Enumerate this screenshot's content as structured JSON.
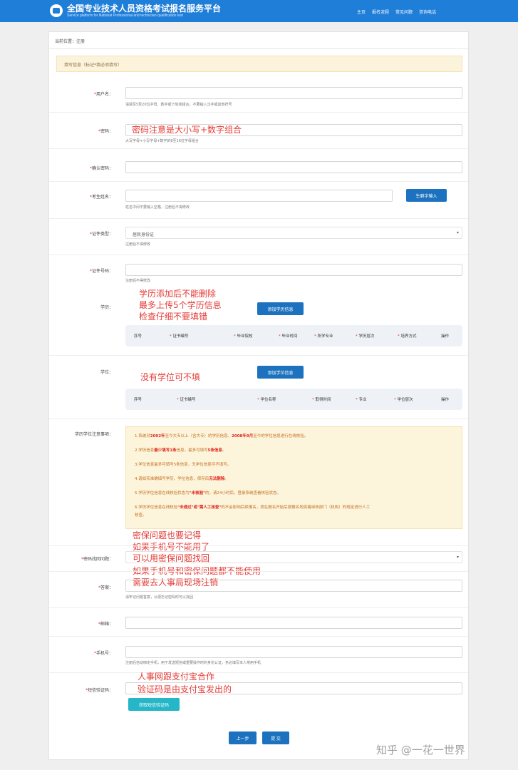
{
  "header": {
    "title": "全国专业技术人员资格考试报名服务平台",
    "subtitle": "Service platform for National Professional and technician qualification test",
    "logo_text": "PTS",
    "nav": [
      "主页",
      "报名流程",
      "常见问题",
      "咨询电话"
    ]
  },
  "breadcrumb": "当前位置：注册",
  "notice": "填写信息（标记*填必须填写）",
  "fields": {
    "username": {
      "label": "用户名：",
      "hint": "请填写5至20位字母、数字或下划线组合，不要输入汉字或其他符号",
      "value": ""
    },
    "password": {
      "label": "密码：",
      "hint": "大写字母+小写字母+数字的8至16位字母组合",
      "value": ""
    },
    "confirm_password": {
      "label": "确认密码：",
      "value": ""
    },
    "name": {
      "label": "考生姓名：",
      "hint": "姓名中间不要输入空格，注册后不得修改",
      "button": "生僻字输入",
      "value": ""
    },
    "id_type": {
      "label": "证件类型：",
      "value": "居民身份证",
      "hint": "注册后不得修改"
    },
    "id_number": {
      "label": "证件号码：",
      "hint": "注册后不得修改",
      "value": ""
    },
    "education": {
      "label": "学历：",
      "button": "添加学历信息",
      "columns": [
        "序号",
        "证书编号",
        "毕业院校",
        "毕业时间",
        "所学专业",
        "学历层次",
        "培养方式",
        "操作"
      ]
    },
    "degree": {
      "label": "学位：",
      "button": "添加学位信息",
      "columns": [
        "序号",
        "证书编号",
        "学位名称",
        "取得时间",
        "专业",
        "学位层次",
        "操作"
      ]
    },
    "edu_notice": {
      "label": "学历学位注意事项：",
      "lines": [
        {
          "a": "1.系统对",
          "b": "2002年",
          "c": "至今大专以上（含大专）的学历信息、",
          "d": "2008年9月",
          "e": "至今的学位信息进行在线核验。"
        },
        {
          "a": "2.学历信息",
          "b": "最少填写1条",
          "c": "信息，最多可填写",
          "d": "5条信息",
          "e": "。"
        },
        {
          "a": "3.学位信息最多可填写5条信息，无学位信息可不填写。",
          "b": "",
          "c": "",
          "d": "",
          "e": ""
        },
        {
          "a": "4.请如实准确填写学历、学位信息，保存后",
          "b": "无法删除",
          "c": "。",
          "d": "",
          "e": ""
        },
        {
          "a": "5.学历学位信息在线核验状态为",
          "b": "\"未核验\"",
          "c": "的，请24小时后，登录系统查看核验状态。",
          "d": "",
          "e": ""
        },
        {
          "a": "6.学历学位信息在线核验",
          "b": "\"未通过\"或\"需人工核查\"",
          "c": "的不会影响后续报名，须在报名开始后按报名地资格审核部门（机构）的规定进行人工",
          "d": "",
          "e": ""
        },
        {
          "a": "核查。",
          "b": "",
          "c": "",
          "d": "",
          "e": ""
        }
      ]
    },
    "security_question": {
      "label": "密码找回问题：",
      "value": ""
    },
    "answer": {
      "label": "答案：",
      "hint": "请牢记问题答案，以便忘记密码时可以找回",
      "value": ""
    },
    "email": {
      "label": "邮箱：",
      "value": ""
    },
    "phone": {
      "label": "手机号：",
      "hint": "注册后自动绑定手机，用于发送短信或重要操作时的身份认证，务必填写本人常用手机",
      "value": ""
    },
    "sms_code": {
      "label": "短信验证码：",
      "button": "获取短信验证码",
      "value": ""
    }
  },
  "annotations": {
    "password": "密码注意是大小写+数字组合",
    "education": [
      "学历添加后不能删除",
      "最多上传5个学历信息",
      "检查仔细不要填错"
    ],
    "degree": "没有学位可不填",
    "security": [
      "密保问题也要记得",
      "如果手机号不能用了",
      "可以用密保问题找回",
      "如果手机号和密保问题都不能使用",
      "需要去人事局现场注销"
    ],
    "sms": [
      "人事网跟支付宝合作",
      "验证码是由支付宝发出的"
    ]
  },
  "buttons": {
    "prev": "上一步",
    "submit": "提 交"
  },
  "watermark": "知乎 @一花一世界",
  "colors": {
    "header": "#1f7ed8",
    "primary_button": "#1c72bf",
    "teal_button": "#25b6c7",
    "annotation": "#e43a36"
  }
}
